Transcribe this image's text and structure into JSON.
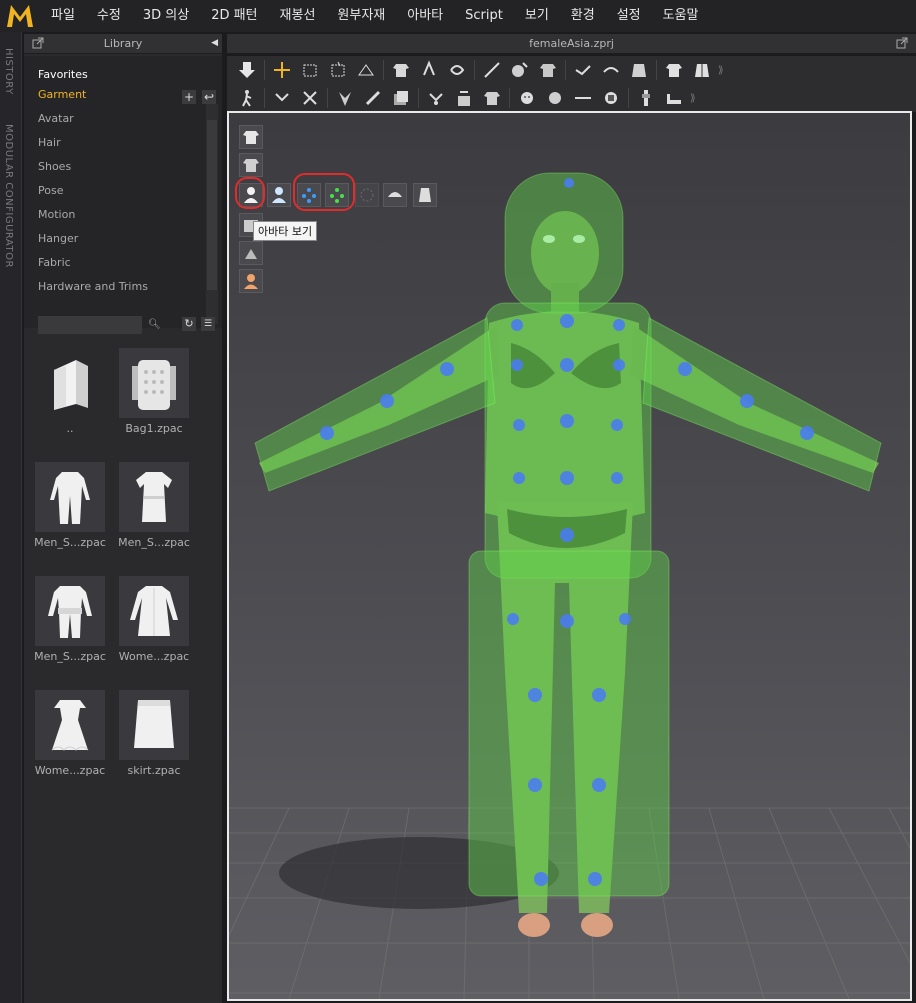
{
  "app": {
    "menu": [
      "파일",
      "수정",
      "3D 의상",
      "2D 패턴",
      "재봉선",
      "원부자재",
      "아바타",
      "Script",
      "보기",
      "환경",
      "설정",
      "도움말"
    ],
    "brand_color": "#f0b420"
  },
  "rail": {
    "history": "HISTORY",
    "modular": "MODULAR CONFIGURATOR"
  },
  "library": {
    "title": "Library",
    "items": [
      {
        "label": "Favorites"
      },
      {
        "label": "Garment"
      },
      {
        "label": "Avatar"
      },
      {
        "label": "Hair"
      },
      {
        "label": "Shoes"
      },
      {
        "label": "Pose"
      },
      {
        "label": "Motion"
      },
      {
        "label": "Hanger"
      },
      {
        "label": "Fabric"
      },
      {
        "label": "Hardware and Trims"
      }
    ],
    "search": {
      "value": "",
      "placeholder": ""
    },
    "files": [
      {
        "label": "..",
        "icon": "folder-icon"
      },
      {
        "label": "Bag1.zpac",
        "icon": "backpack-icon"
      },
      {
        "label": "Men_S...zpac",
        "icon": "suit-icon"
      },
      {
        "label": "Men_S...zpac",
        "icon": "shirt-dress-icon"
      },
      {
        "label": "Men_S...zpac",
        "icon": "jacket-suit-icon"
      },
      {
        "label": "Wome...zpac",
        "icon": "coat-dress-icon"
      },
      {
        "label": "Wome...zpac",
        "icon": "ruffle-dress-icon"
      },
      {
        "label": "skirt.zpac",
        "icon": "skirt-icon"
      }
    ]
  },
  "viewport": {
    "file_name": "femaleAsia.zprj",
    "tooltip": "아바타 보기"
  }
}
